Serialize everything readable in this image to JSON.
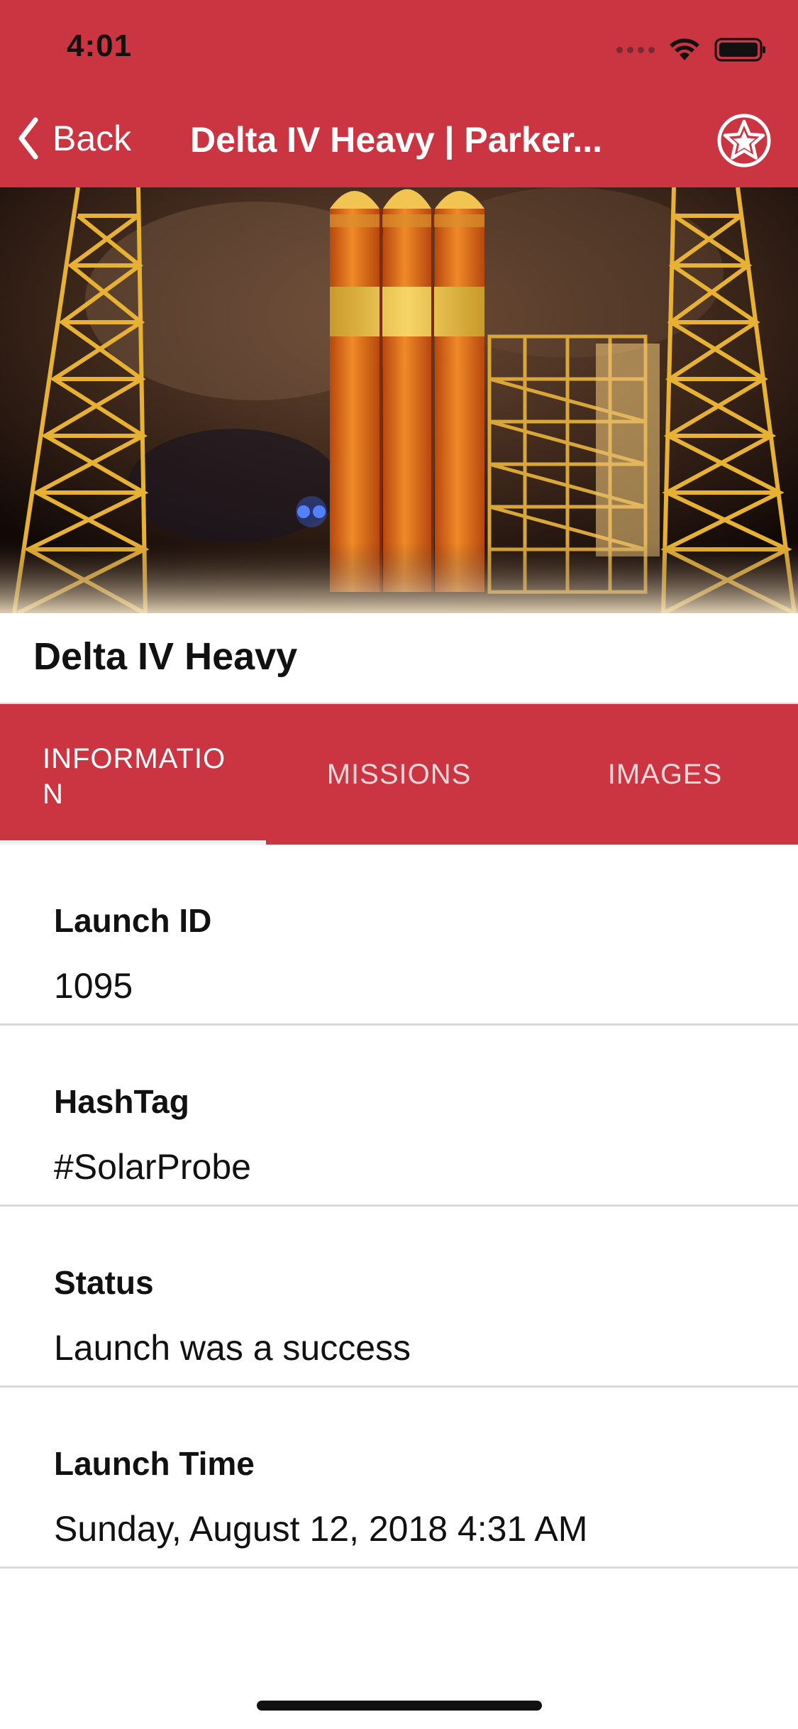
{
  "status_bar": {
    "time": "4:01"
  },
  "nav": {
    "back_label": "Back",
    "title": "Delta IV Heavy | Parker...",
    "favorite_icon": "star-icon"
  },
  "rocket": {
    "name": "Delta IV Heavy"
  },
  "tabs": [
    {
      "label": "INFORMATIO N",
      "selected": true
    },
    {
      "label": "MISSIONS",
      "selected": false
    },
    {
      "label": "IMAGES",
      "selected": false
    }
  ],
  "info": [
    {
      "label": "Launch ID",
      "value": "1095"
    },
    {
      "label": "HashTag",
      "value": "#SolarProbe"
    },
    {
      "label": "Status",
      "value": "Launch was a success"
    },
    {
      "label": "Launch Time",
      "value": "Sunday, August 12, 2018 4:31 AM"
    }
  ],
  "colors": {
    "accent": "#cb3542",
    "header_text": "#ffffff",
    "tab_inactive_text": "#f4d6d9"
  }
}
